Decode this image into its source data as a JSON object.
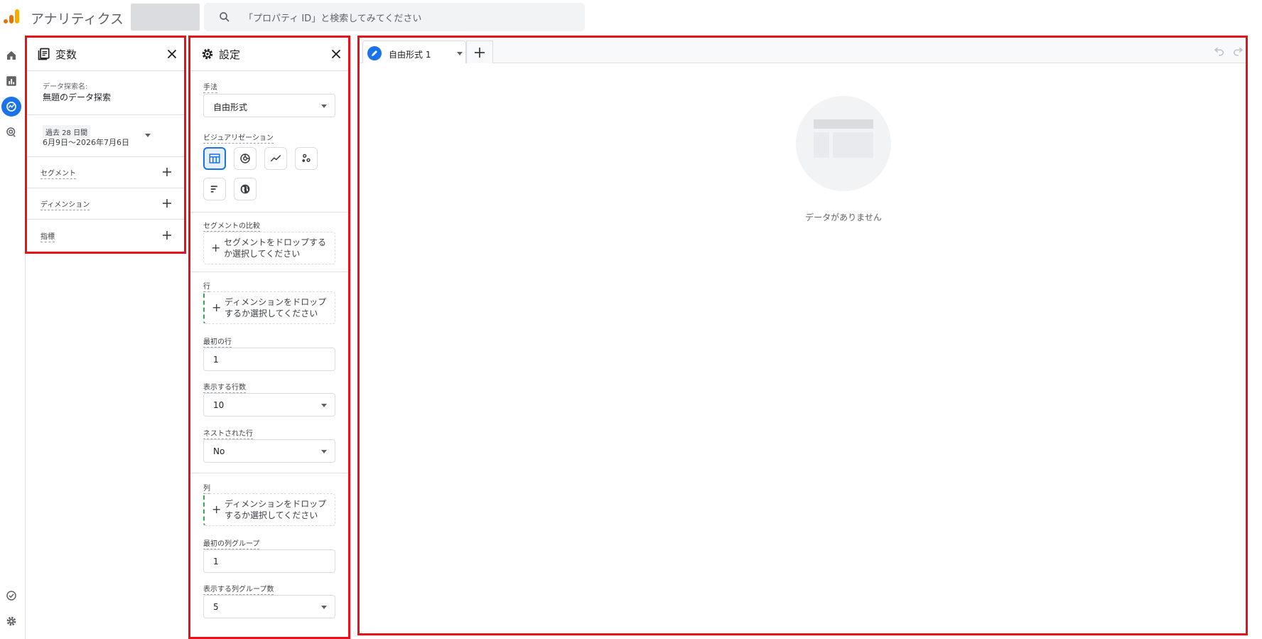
{
  "app": {
    "title": "アナリティクス",
    "search_placeholder": "「プロパティ ID」と検索してみてください"
  },
  "rail": {
    "icons": [
      "home-icon",
      "reports-icon",
      "explore-icon",
      "advertising-icon",
      "checklist-icon",
      "settings-gear-icon"
    ],
    "active": "explore-icon"
  },
  "variables": {
    "title": "変数",
    "exploration_name_label": "データ探索名:",
    "exploration_name": "無題のデータ探索",
    "date_range_chip": "過去 28 日間",
    "date_range_value": "6月9日～2026年7月6日",
    "segments_label": "セグメント",
    "dimensions_label": "ディメンション",
    "metrics_label": "指標"
  },
  "settings": {
    "title": "設定",
    "technique_label": "手法",
    "technique_value": "自由形式",
    "visualization_label": "ビジュアリゼーション",
    "visualizations": [
      "table-icon",
      "donut-chart-icon",
      "line-chart-icon",
      "scatter-plot-icon",
      "bar-chart-icon",
      "geo-map-icon"
    ],
    "segment_compare_label": "セグメントの比較",
    "segment_drop_text": "セグメントをドロップするか選択してください",
    "rows_label": "行",
    "rows_drop_text": "ディメンションをドロップするか選択してください",
    "first_row_label": "最初の行",
    "first_row_value": "1",
    "show_rows_label": "表示する行数",
    "show_rows_value": "10",
    "nested_rows_label": "ネストされた行",
    "nested_rows_value": "No",
    "columns_label": "列",
    "columns_drop_text": "ディメンションをドロップするか選択してください",
    "first_col_group_label": "最初の列グループ",
    "first_col_group_value": "1",
    "show_col_groups_label": "表示する列グループ数",
    "show_col_groups_value": "5"
  },
  "canvas": {
    "tab_name": "自由形式 1",
    "empty_message": "データがありません"
  },
  "colors": {
    "highlight_border": "#e8111b",
    "accent": "#1a73e8",
    "brand_orange": "#e37400",
    "brand_yellow": "#f9ab00"
  }
}
